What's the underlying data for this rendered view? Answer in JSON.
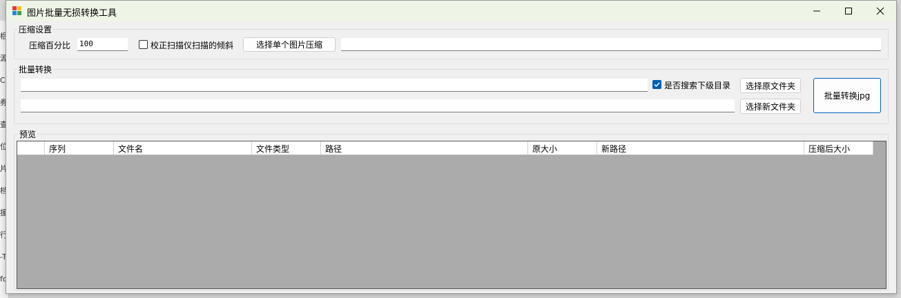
{
  "background_app": {
    "edge_chars": [
      "梠",
      "源",
      "C",
      "券",
      "查",
      "位",
      "片",
      "档",
      "援",
      "行",
      "-T",
      "fo"
    ]
  },
  "window": {
    "title": "图片批量无损转换工具",
    "icon": "app-image-icon",
    "controls": [
      "minimize-icon",
      "maximize-icon",
      "close-icon"
    ]
  },
  "compress": {
    "group_label": "压缩设置",
    "percent_label": "压缩百分比",
    "percent_value": "100",
    "deskew_label": "校正扫描仪扫描的倾斜",
    "deskew_checked": false,
    "single_button": "选择单个图片压缩",
    "single_path": ""
  },
  "batch": {
    "group_label": "批量转换",
    "source_path": "",
    "dest_path": "",
    "subdir_label": "是否搜索下级目录",
    "subdir_checked": true,
    "source_button": "选择原文件夹",
    "dest_button": "选择新文件夹",
    "convert_button": "批量转换jpg"
  },
  "preview": {
    "group_label": "预览",
    "columns": [
      "",
      "序列",
      "文件名",
      "文件类型",
      "路径",
      "原大小",
      "新路径",
      "压缩后大小"
    ],
    "rows": []
  },
  "colors": {
    "accent": "#005fb8",
    "titlebar": "#eef5e6",
    "grid_bg": "#ababab"
  }
}
